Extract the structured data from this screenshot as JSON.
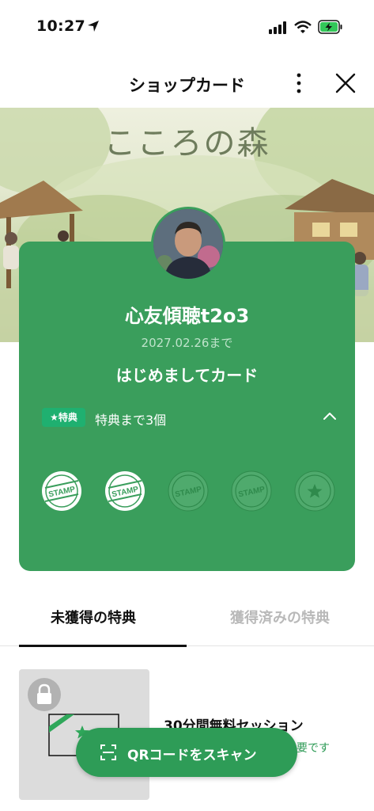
{
  "status_bar": {
    "time": "10:27"
  },
  "header": {
    "title": "ショップカード"
  },
  "banner": {
    "title": "こころの森"
  },
  "card": {
    "name": "心友傾聴t2o3",
    "expiry": "2027.02.26まで",
    "card_type": "はじめましてカード",
    "benefit_badge": "★特典",
    "benefit_text": "特典まで3個",
    "stamp_label": "STAMP",
    "stamps_collected": 2,
    "stamps_total": 5
  },
  "tabs": [
    {
      "label": "未獲得の特典",
      "active": true
    },
    {
      "label": "獲得済みの特典",
      "active": false
    }
  ],
  "reward": {
    "title": "30分間無料セッション",
    "note": "要です"
  },
  "qr_button": {
    "label": "QRコードをスキャン"
  },
  "colors": {
    "card_green": "#3a9e5c",
    "button_green": "#2e9c57",
    "badge_green": "#1fb070"
  }
}
